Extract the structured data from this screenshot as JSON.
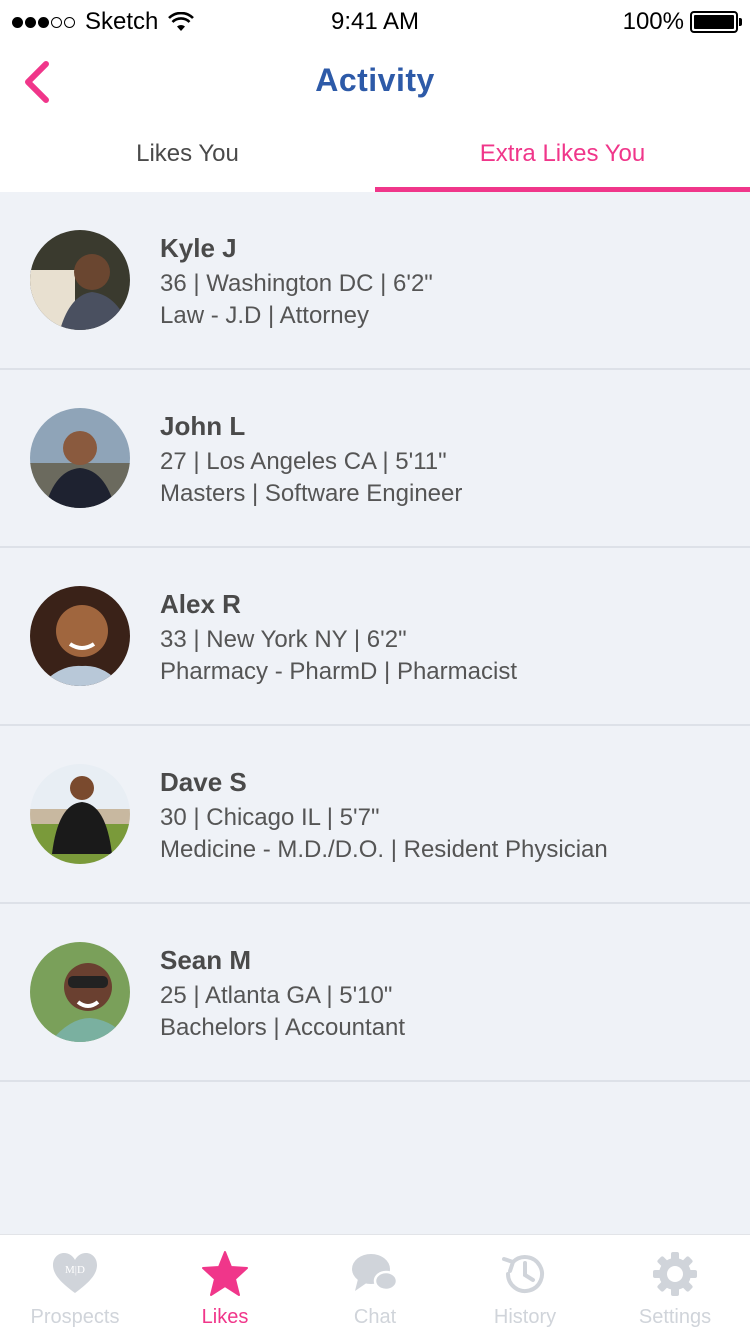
{
  "status_bar": {
    "carrier": "Sketch",
    "time": "9:41 AM",
    "battery": "100%"
  },
  "nav": {
    "title": "Activity",
    "back_icon": "chevron-left-icon"
  },
  "tabs": [
    {
      "label": "Likes You",
      "active": false
    },
    {
      "label": "Extra Likes You",
      "active": true
    }
  ],
  "profiles": [
    {
      "name": "Kyle J",
      "details": "36 | Washington DC | 6'2\"",
      "career": "Law - J.D | Attorney"
    },
    {
      "name": "John L",
      "details": "27 | Los Angeles CA | 5'11\"",
      "career": "Masters | Software Engineer"
    },
    {
      "name": "Alex R",
      "details": "33 | New York NY | 6'2\"",
      "career": "Pharmacy - PharmD | Pharmacist"
    },
    {
      "name": "Dave S",
      "details": "30 | Chicago IL | 5'7\"",
      "career": "Medicine - M.D./D.O. | Resident Physician"
    },
    {
      "name": "Sean M",
      "details": "25 | Atlanta GA | 5'10\"",
      "career": "Bachelors | Accountant"
    }
  ],
  "tab_bar": [
    {
      "label": "Prospects",
      "icon": "heart-md-icon",
      "active": false
    },
    {
      "label": "Likes",
      "icon": "star-icon",
      "active": true
    },
    {
      "label": "Chat",
      "icon": "chat-bubbles-icon",
      "active": false
    },
    {
      "label": "History",
      "icon": "history-clock-icon",
      "active": false
    },
    {
      "label": "Settings",
      "icon": "gear-icon",
      "active": false
    }
  ],
  "colors": {
    "accent": "#f0368a",
    "title": "#2d5aa8",
    "background": "#eff2f7",
    "inactive_tab_icon": "#d0d4da"
  }
}
